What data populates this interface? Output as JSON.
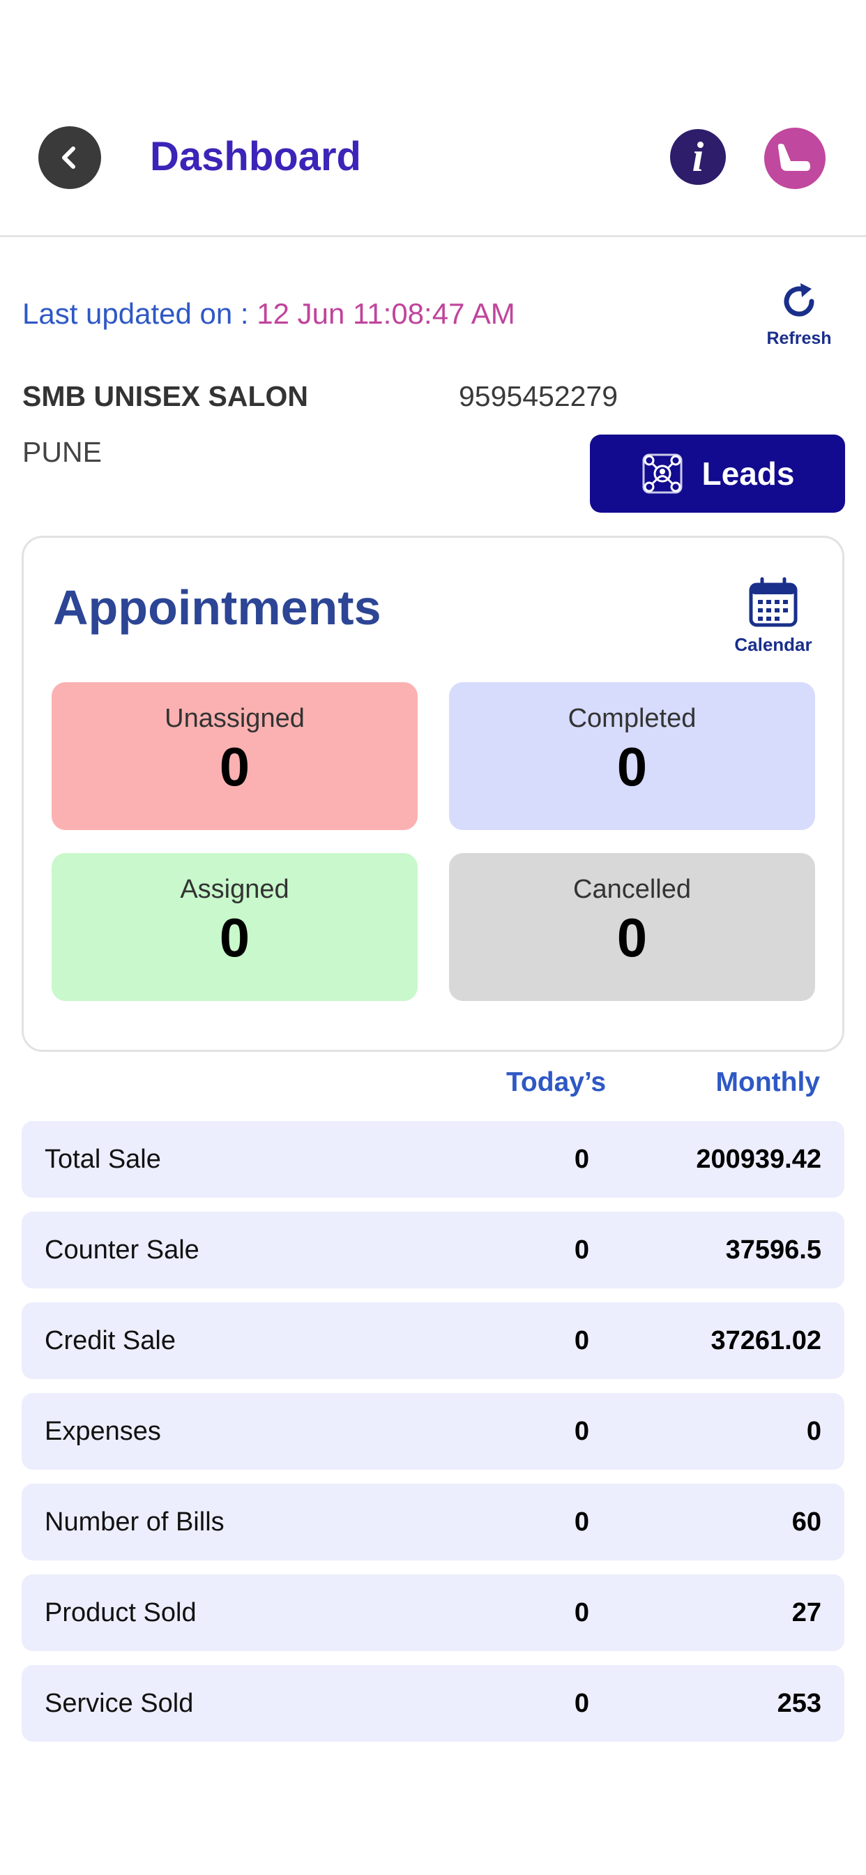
{
  "header": {
    "title": "Dashboard",
    "back_icon": "chevron-left-icon",
    "info_icon": "info-icon",
    "profile_icon": "salon-chair-icon"
  },
  "status": {
    "last_updated_label": "Last updated on : ",
    "last_updated_value": "12 Jun 11:08:47 AM",
    "refresh_label": "Refresh"
  },
  "salon": {
    "name": "SMB UNISEX SALON",
    "phone": "9595452279",
    "city": "PUNE"
  },
  "leads": {
    "label": "Leads"
  },
  "appointments": {
    "title": "Appointments",
    "calendar_label": "Calendar",
    "tiles": [
      {
        "label": "Unassigned",
        "count": "0",
        "color": "#fbb1b1"
      },
      {
        "label": "Completed",
        "count": "0",
        "color": "#d7dbfc"
      },
      {
        "label": "Assigned",
        "count": "0",
        "color": "#c8f8cb"
      },
      {
        "label": "Cancelled",
        "count": "0",
        "color": "#d8d8d8"
      }
    ]
  },
  "sales": {
    "headers": {
      "today": "Today’s",
      "monthly": "Monthly"
    },
    "rows": [
      {
        "label": "Total Sale",
        "today": "0",
        "monthly": "200939.42"
      },
      {
        "label": "Counter Sale",
        "today": "0",
        "monthly": "37596.5"
      },
      {
        "label": "Credit Sale",
        "today": "0",
        "monthly": "37261.02"
      },
      {
        "label": "Expenses",
        "today": "0",
        "monthly": "0"
      },
      {
        "label": "Number of Bills",
        "today": "0",
        "monthly": "60"
      },
      {
        "label": "Product Sold",
        "today": "0",
        "monthly": "27"
      },
      {
        "label": "Service Sold",
        "today": "0",
        "monthly": "253"
      }
    ]
  },
  "colors": {
    "title": "#3b24b8",
    "accent_blue": "#2e58c4",
    "accent_pink": "#c0449b",
    "leads_button": "#120a8f",
    "row_background": "#eceefd"
  }
}
